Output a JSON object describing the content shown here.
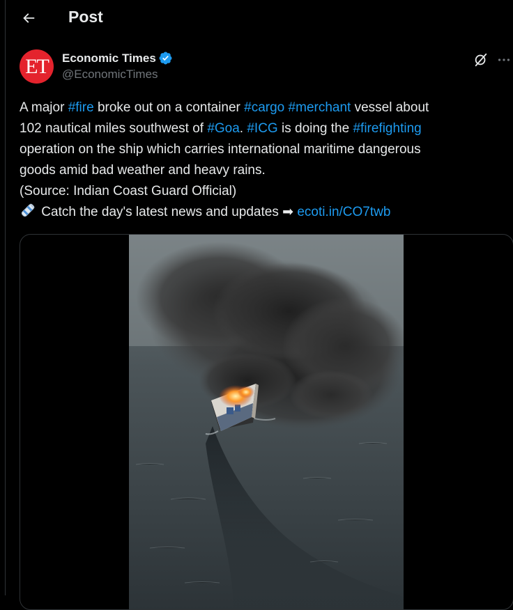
{
  "header": {
    "title": "Post"
  },
  "author": {
    "avatar_text": "ET",
    "name": "Economic Times",
    "handle": "@EconomicTimes"
  },
  "tweet": {
    "l1_a": "A major ",
    "l1_tag1": "#fire",
    "l1_b": " broke out on a container ",
    "l1_tag2": "#cargo",
    "l1_c": " ",
    "l1_tag3": "#merchant",
    "l1_d": " vessel about",
    "l2_a": "102 nautical miles southwest of ",
    "l2_tag1": "#Goa",
    "l2_b": ". ",
    "l2_tag2": "#ICG",
    "l2_c": " is doing the ",
    "l2_tag3": "#firefighting",
    "l3": "operation on the ship which carries international maritime dangerous",
    "l4": "goods amid bad weather and heavy rains.",
    "l5": "(Source: Indian Coast Guard Official)",
    "l6_a": " Catch the day's latest news and updates ➡ ",
    "l6_link": "ecoti.in/CO7twb"
  },
  "colors": {
    "accent": "#1d9bf0",
    "avatar_bg": "#e4232d",
    "text": "#e7e9ea",
    "muted": "#71767b"
  },
  "icons": {
    "back": "arrow-left-icon",
    "verified": "verified-badge-icon",
    "grok": "grok-icon",
    "more": "more-icon",
    "news": "newspaper-roll-icon"
  }
}
